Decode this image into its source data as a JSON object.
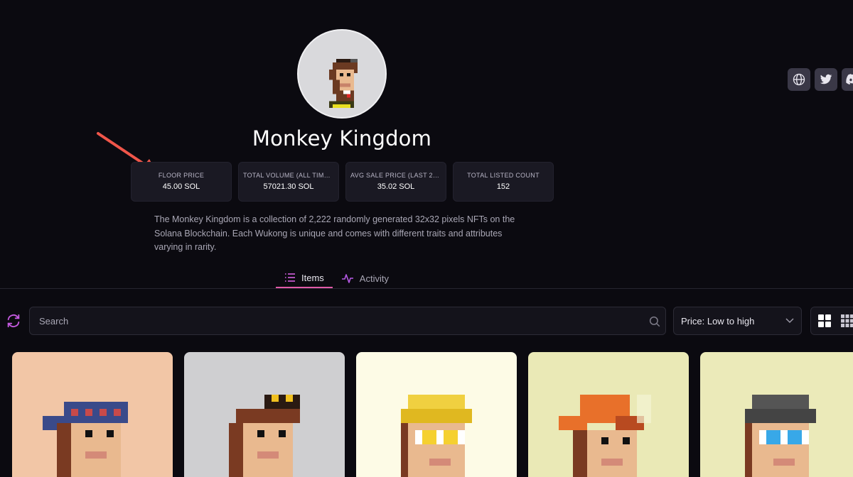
{
  "collection": {
    "title": "Monkey Kingdom",
    "description": "The Monkey Kingdom is a collection of 2,222 randomly generated 32x32 pixels NFTs on the Solana Blockchain. Each Wukong is unique and comes with different traits and attributes varying in rarity.",
    "avatar_icon": "monkey-avatar"
  },
  "socials": [
    {
      "icon": "globe-icon"
    },
    {
      "icon": "twitter-icon"
    },
    {
      "icon": "discord-icon"
    }
  ],
  "stats": [
    {
      "label": "FLOOR PRICE",
      "value": "45.00 SOL"
    },
    {
      "label": "TOTAL VOLUME (ALL TIME...",
      "value": "57021.30 SOL"
    },
    {
      "label": "AVG SALE PRICE (LAST 24...",
      "value": "35.02 SOL"
    },
    {
      "label": "TOTAL LISTED COUNT",
      "value": "152"
    }
  ],
  "tabs": [
    {
      "label": "Items",
      "icon": "list-icon",
      "active": true
    },
    {
      "label": "Activity",
      "icon": "activity-icon",
      "active": false
    }
  ],
  "filters": {
    "search_placeholder": "Search",
    "sort_selected": "Price: Low to high"
  },
  "colors": {
    "accent": "#e05aa8",
    "background": "#0b0a10",
    "annotation_arrow": "#f0564a"
  },
  "cards": [
    {
      "bg": "#f2c6a6",
      "hat": "bandana"
    },
    {
      "bg": "#cfcfd1",
      "hat": "goggles"
    },
    {
      "bg": "#fdfbe6",
      "hat": "yellow-hair"
    },
    {
      "bg": "#eae9b6",
      "hat": "orange-cap"
    },
    {
      "bg": "#ebeab9",
      "hat": "grey-hair"
    }
  ]
}
